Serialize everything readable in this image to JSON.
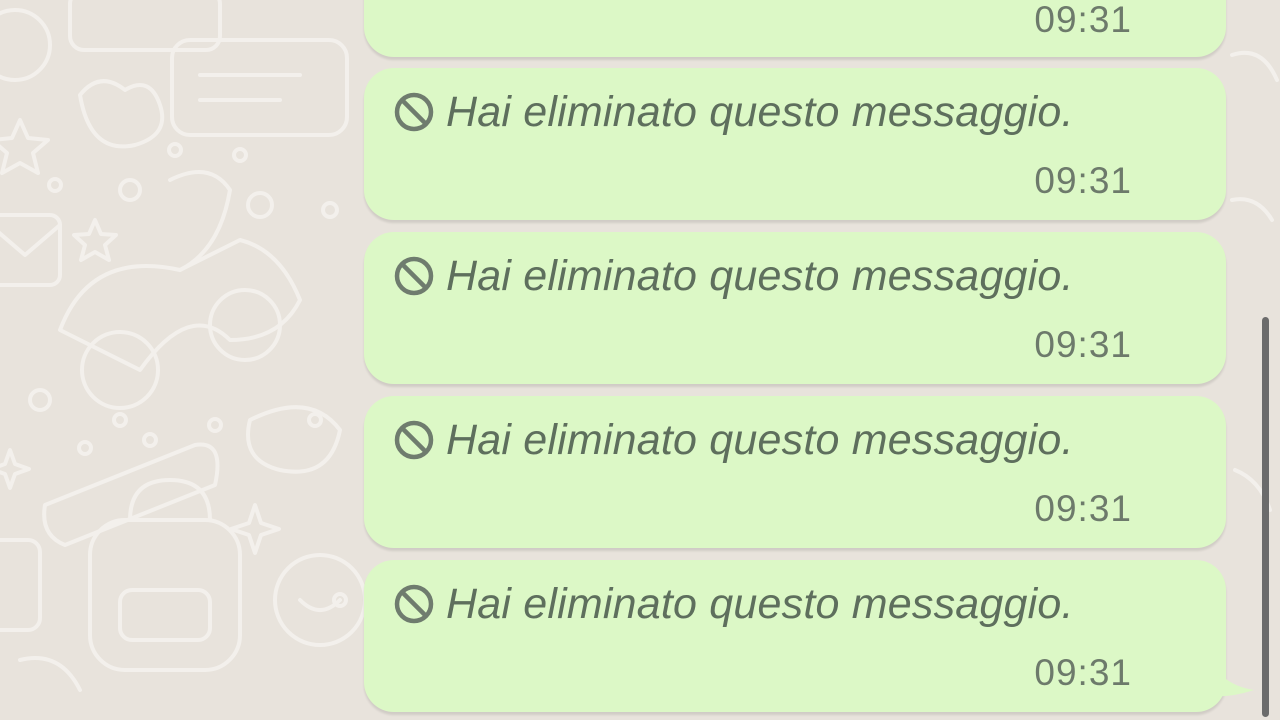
{
  "chat": {
    "messages": [
      {
        "text": "",
        "time": "09:31",
        "deleted": false
      },
      {
        "text": "Hai eliminato questo messaggio.",
        "time": "09:31",
        "deleted": true,
        "icon": "deleted-icon"
      },
      {
        "text": "Hai eliminato questo messaggio.",
        "time": "09:31",
        "deleted": true,
        "icon": "deleted-icon"
      },
      {
        "text": "Hai eliminato questo messaggio.",
        "time": "09:31",
        "deleted": true,
        "icon": "deleted-icon"
      },
      {
        "text": "Hai eliminato questo messaggio.",
        "time": "09:31",
        "deleted": true,
        "icon": "deleted-icon"
      }
    ]
  },
  "colors": {
    "background": "#e8e3dc",
    "bubble_outgoing": "#dcf8c6",
    "deleted_text": "#5e6f5d",
    "timestamp": "#6d7a6b",
    "scrollbar": "#6b6b6b"
  }
}
